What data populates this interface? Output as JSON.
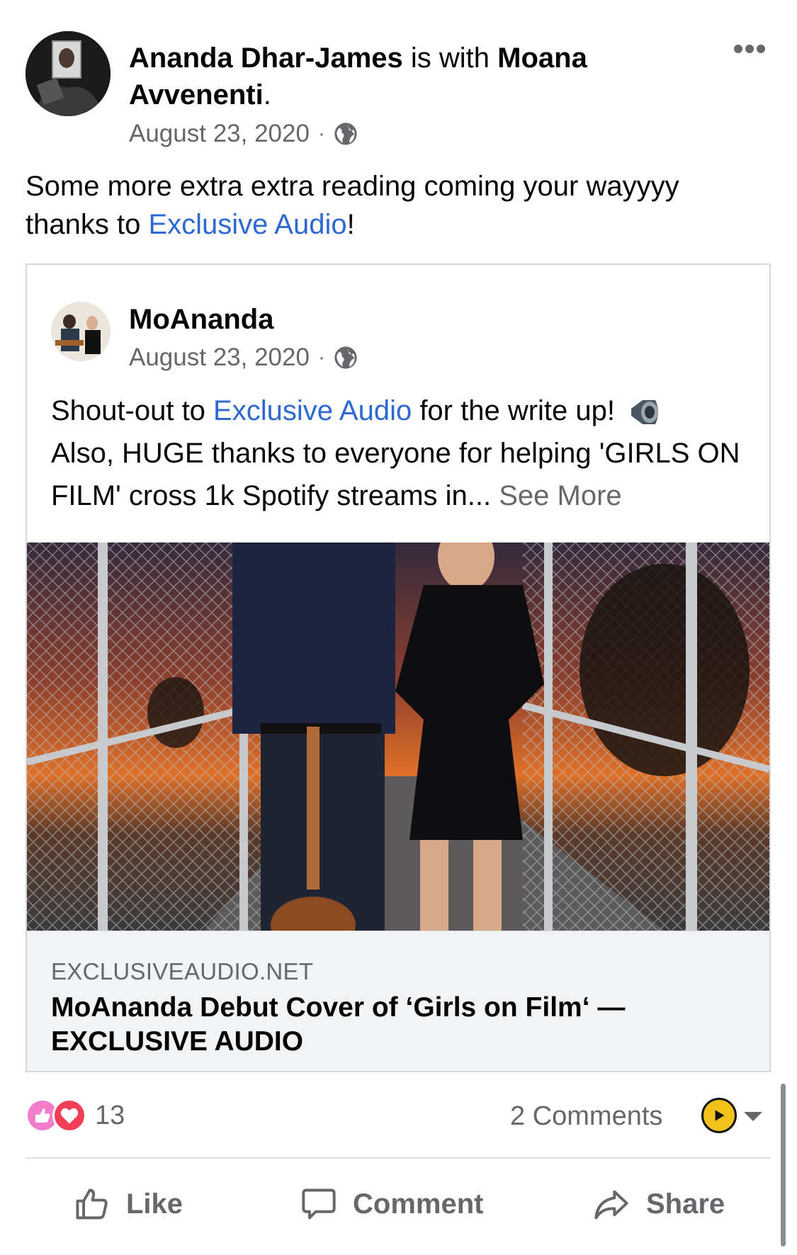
{
  "post": {
    "author": "Ananda Dhar-James",
    "with_text": " is with ",
    "tagged": "Moana Avvenenti",
    "tagged_suffix": ".",
    "date": "August 23, 2020",
    "privacy_icon": "globe-icon",
    "text_before_link": "Some more extra extra reading coming your wayyyy thanks to ",
    "text_link": "Exclusive Audio",
    "text_after_link": "!"
  },
  "shared": {
    "page_name": "MoAnanda",
    "date": "August 23, 2020",
    "privacy_icon": "globe-icon",
    "text_pre": "Shout-out to ",
    "text_link": "Exclusive Audio",
    "text_mid": " for the write up! ",
    "text_rest": "Also, HUGE thanks to everyone for helping 'GIRLS ON FILM' cross 1k Spotify streams in... ",
    "see_more": "See More",
    "link_preview": {
      "domain": "EXCLUSIVEAUDIO.NET",
      "title": "MoAnanda Debut Cover of ‘Girls on Film‘ — EXCLUSIVE AUDIO"
    }
  },
  "stats": {
    "reaction_count": "13",
    "comments": "2 Comments",
    "reaction_icons": [
      "care-icon",
      "love-icon"
    ]
  },
  "actions": {
    "like": "Like",
    "comment": "Comment",
    "share": "Share"
  },
  "colors": {
    "link": "#2d68d3",
    "secondary_text": "#65676b",
    "preview_bg": "#f2f3f5"
  }
}
